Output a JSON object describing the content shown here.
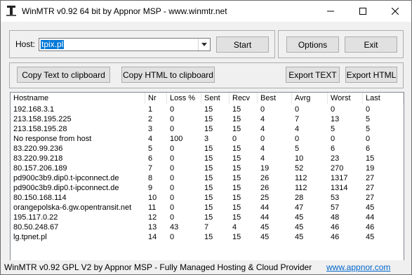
{
  "window": {
    "title": "WinMTR v0.92 64 bit by Appnor MSP - www.winmtr.net"
  },
  "titlebar_buttons": {
    "minimize": "—",
    "maximize": "☐",
    "close": "✕"
  },
  "host": {
    "label": "Host:",
    "value": "tpix.pl",
    "dropdown_icon": "chevron-down-icon"
  },
  "buttons": {
    "start": "Start",
    "options": "Options",
    "exit": "Exit",
    "copy_text": "Copy Text to clipboard",
    "copy_html": "Copy HTML to clipboard",
    "export_text": "Export TEXT",
    "export_html": "Export HTML"
  },
  "table": {
    "columns": [
      "Hostname",
      "Nr",
      "Loss %",
      "Sent",
      "Recv",
      "Best",
      "Avrg",
      "Worst",
      "Last"
    ],
    "rows": [
      [
        "192.168.3.1",
        "1",
        "0",
        "15",
        "15",
        "0",
        "0",
        "0",
        "0"
      ],
      [
        "213.158.195.225",
        "2",
        "0",
        "15",
        "15",
        "4",
        "7",
        "13",
        "5"
      ],
      [
        "213.158.195.28",
        "3",
        "0",
        "15",
        "15",
        "4",
        "4",
        "5",
        "5"
      ],
      [
        "No response from host",
        "4",
        "100",
        "3",
        "0",
        "0",
        "0",
        "0",
        "0"
      ],
      [
        "83.220.99.236",
        "5",
        "0",
        "15",
        "15",
        "4",
        "5",
        "6",
        "6"
      ],
      [
        "83.220.99.218",
        "6",
        "0",
        "15",
        "15",
        "4",
        "10",
        "23",
        "15"
      ],
      [
        "80.157.206.189",
        "7",
        "0",
        "15",
        "15",
        "19",
        "52",
        "270",
        "19"
      ],
      [
        "pd900c3b9.dip0.t-ipconnect.de",
        "8",
        "0",
        "15",
        "15",
        "26",
        "112",
        "1317",
        "27"
      ],
      [
        "pd900c3b9.dip0.t-ipconnect.de",
        "9",
        "0",
        "15",
        "15",
        "26",
        "112",
        "1314",
        "27"
      ],
      [
        "80.150.168.114",
        "10",
        "0",
        "15",
        "15",
        "25",
        "28",
        "53",
        "27"
      ],
      [
        "orangepolska-6.gw.opentransit.net",
        "11",
        "0",
        "15",
        "15",
        "44",
        "47",
        "57",
        "45"
      ],
      [
        "195.117.0.22",
        "12",
        "0",
        "15",
        "15",
        "44",
        "45",
        "48",
        "44"
      ],
      [
        "80.50.248.67",
        "13",
        "43",
        "7",
        "4",
        "45",
        "45",
        "46",
        "46"
      ],
      [
        "lg.tpnet.pl",
        "14",
        "0",
        "15",
        "15",
        "45",
        "45",
        "46",
        "45"
      ]
    ]
  },
  "status": {
    "text": "WinMTR v0.92 GPL V2 by Appnor MSP - Fully Managed Hosting & Cloud Provider",
    "link": "www.appnor.com"
  }
}
